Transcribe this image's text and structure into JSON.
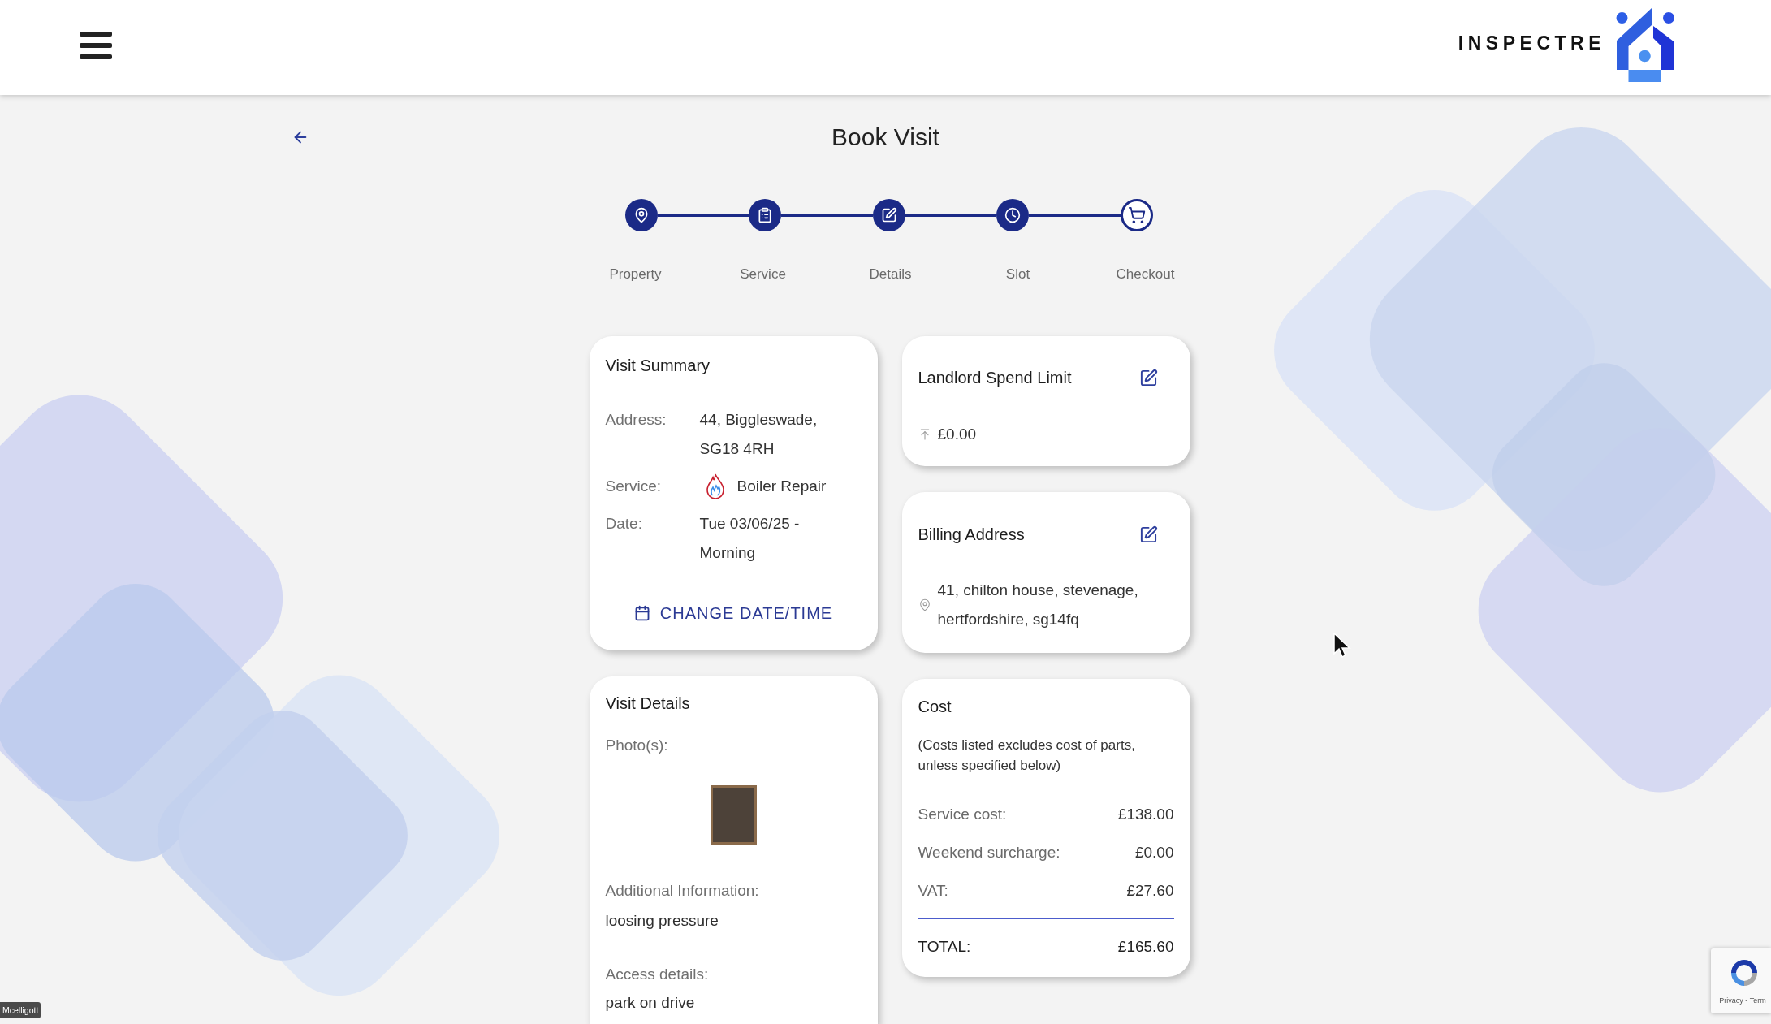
{
  "header": {
    "logo_text": "INSPECTRE"
  },
  "page": {
    "title": "Book Visit"
  },
  "stepper": [
    {
      "label": "Property",
      "completed": true
    },
    {
      "label": "Service",
      "completed": true
    },
    {
      "label": "Details",
      "completed": true
    },
    {
      "label": "Slot",
      "completed": true
    },
    {
      "label": "Checkout",
      "completed": false
    }
  ],
  "visit_summary": {
    "title": "Visit Summary",
    "rows": [
      {
        "kind": "text",
        "label": "Address:",
        "value": "44, Biggleswade, SG18 4RH"
      },
      {
        "kind": "service",
        "label": "Service:",
        "value": "Boiler Repair"
      },
      {
        "kind": "text",
        "label": "Date:",
        "value": "Tue 03/06/25 - Morning"
      }
    ],
    "change_button": "CHANGE DATE/TIME"
  },
  "landlord_spend_limit": {
    "title": "Landlord Spend Limit",
    "amount": "£0.00"
  },
  "billing_address": {
    "title": "Billing Address",
    "address": "41, chilton house, stevenage, hertfordshire, sg14fq"
  },
  "visit_details": {
    "title": "Visit Details",
    "photos_label": "Photo(s):",
    "additional_information_label": "Additional Information:",
    "additional_information": "loosing pressure",
    "access_details_label": "Access details:",
    "access_details": "park on drive"
  },
  "cost": {
    "title": "Cost",
    "note": "(Costs listed excludes cost of parts, unless specified below)",
    "rows": [
      {
        "label": "Service cost:",
        "value": "£138.00"
      },
      {
        "label": "Weekend surcharge:",
        "value": "£0.00"
      },
      {
        "label": "VAT:",
        "value": "£27.60"
      }
    ],
    "total": {
      "label": "TOTAL:",
      "value": "£165.60"
    }
  },
  "recaptcha": {
    "text": "Privacy - Term"
  },
  "user_tag": "Mcelligott"
}
